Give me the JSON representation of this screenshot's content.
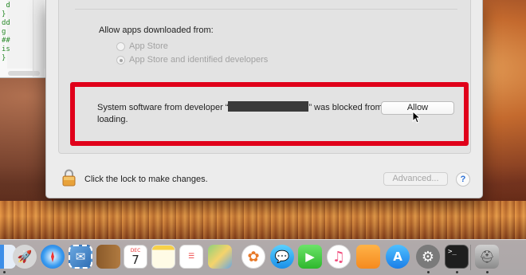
{
  "terminal": {
    "lines": [
      " d",
      "}",
      "dd",
      "g",
      "##",
      "is",
      "}"
    ]
  },
  "security_pane": {
    "allow_heading": "Allow apps downloaded from:",
    "radio_options": [
      {
        "label": "App Store",
        "selected": false,
        "enabled": false
      },
      {
        "label": "App Store and identified developers",
        "selected": true,
        "enabled": false
      }
    ],
    "blocked_message_prefix": "System software from developer “",
    "blocked_message_suffix": "” was blocked from loading.",
    "allow_button": "Allow",
    "lock_text": "Click the lock to make changes.",
    "advanced_button": "Advanced...",
    "help_button": "?"
  },
  "colors": {
    "highlight_frame": "#e0001a",
    "pane_bg": "#ececec"
  },
  "dock": {
    "items": [
      {
        "name": "finder",
        "icon": "finder-icon"
      },
      {
        "name": "launchpad",
        "icon": "rocket-icon"
      },
      {
        "name": "safari",
        "icon": "compass-icon"
      },
      {
        "name": "mail",
        "icon": "stamp-icon"
      },
      {
        "name": "contacts",
        "icon": "book-icon"
      },
      {
        "name": "calendar",
        "icon": "calendar-icon",
        "label_month": "DEC",
        "label_day": "7"
      },
      {
        "name": "notes",
        "icon": "notes-icon"
      },
      {
        "name": "reminders",
        "icon": "list-icon"
      },
      {
        "name": "maps",
        "icon": "map-icon"
      },
      {
        "name": "photos",
        "icon": "flower-icon"
      },
      {
        "name": "messages",
        "icon": "chat-bubble-icon"
      },
      {
        "name": "facetime",
        "icon": "video-camera-icon"
      },
      {
        "name": "itunes",
        "icon": "music-note-icon"
      },
      {
        "name": "ibooks",
        "icon": "open-book-icon"
      },
      {
        "name": "app-store",
        "icon": "app-store-icon"
      },
      {
        "name": "system-preferences",
        "icon": "gear-icon"
      },
      {
        "name": "terminal",
        "icon": "terminal-icon",
        "label": ">_"
      },
      {
        "name": "disk-utility",
        "icon": "disk-icon"
      }
    ]
  }
}
